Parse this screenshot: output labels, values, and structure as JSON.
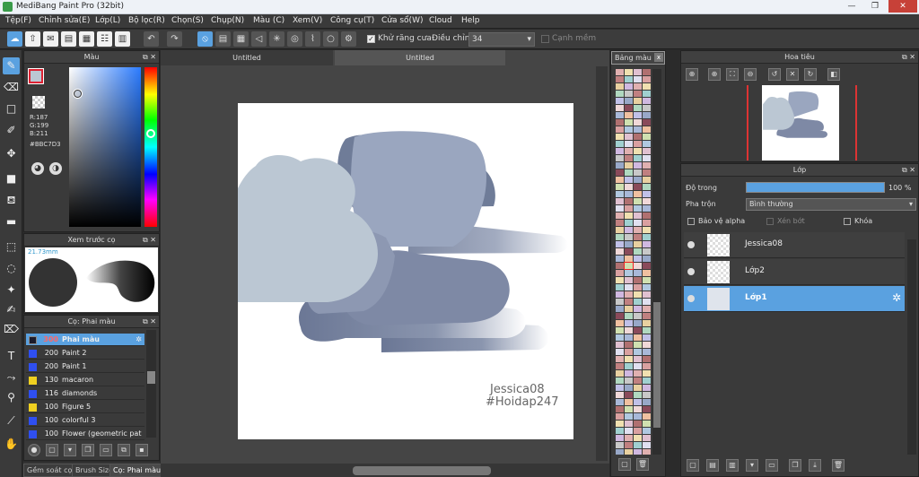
{
  "app": {
    "title": "MediBang Paint Pro (32bit)",
    "min": "—",
    "max": "❐",
    "close": "✕"
  },
  "menu": [
    "Tệp(F)",
    "Chỉnh sửa(E)",
    "Lớp(L)",
    "Bộ lọc(R)",
    "Chọn(S)",
    "Chụp(N)",
    "Màu (C)",
    "Xem(V)",
    "Công cụ(T)",
    "Cửa sổ(W)",
    "Cloud",
    "Help"
  ],
  "toolbar": {
    "antialias_label": "Khử răng cưa",
    "antialias_checked": true,
    "adjust_label": "Điều chỉnh",
    "adjust_value": "34",
    "smooth_label": "Cạnh mềm",
    "smooth_checked": false
  },
  "color_panel": {
    "title": "Màu",
    "fg": "#bbc7d3",
    "bg": "#ffffff",
    "r": "R:187",
    "g": "G:199",
    "b": "B:211",
    "hex": "#BBC7D3"
  },
  "preview_panel": {
    "title": "Xem trước cọ",
    "size": "21.73mm"
  },
  "brush_panel": {
    "title": "Cọ: Phai màu",
    "items": [
      {
        "size": "300",
        "name": "Phai màu",
        "color": "#1b1b2b",
        "selected": true
      },
      {
        "size": "200",
        "name": "Paint 2",
        "color": "#2f4ff0"
      },
      {
        "size": "200",
        "name": "Paint 1",
        "color": "#2f4ff0"
      },
      {
        "size": "130",
        "name": "macaron",
        "color": "#f0d020"
      },
      {
        "size": "116",
        "name": "diamonds",
        "color": "#2f4ff0"
      },
      {
        "size": "100",
        "name": "Figure 5",
        "color": "#f0d020"
      },
      {
        "size": "100",
        "name": "colorful 3",
        "color": "#2f4ff0"
      },
      {
        "size": "100",
        "name": "Flower (geometric pat",
        "color": "#2f4ff0"
      }
    ]
  },
  "left_tabs": [
    "Gềm soát cọ",
    "Brush Size",
    "Cọ: Phai màu"
  ],
  "canvas": {
    "tabs": [
      "Untitled",
      "Untitled"
    ],
    "signature_1": "Jessica08",
    "signature_2": "#Hoidap247"
  },
  "palette_panel": {
    "title": "Bảng màu",
    "close": "x"
  },
  "navigator": {
    "title": "Hoa tiêu"
  },
  "layer_panel": {
    "title": "Lớp",
    "opacity_label": "Độ trong",
    "opacity_value": "100 %",
    "opacity_fraction": 1.0,
    "blend_label": "Pha trộn",
    "blend_value": "Bình thường",
    "protect_alpha": "Bảo vệ alpha",
    "clipping": "Xén bớt",
    "lock": "Khóa",
    "layers": [
      {
        "name": "Jessica08",
        "selected": false
      },
      {
        "name": "Lớp2",
        "selected": false
      },
      {
        "name": "Lớp1",
        "selected": true
      }
    ]
  },
  "colors": {
    "accent": "#5aa1e0",
    "panel": "#3a3a3a",
    "cloud_light": "#bbc7d3",
    "cloud_mid": "#8792ab",
    "cloud_dark": "#6b7795"
  }
}
